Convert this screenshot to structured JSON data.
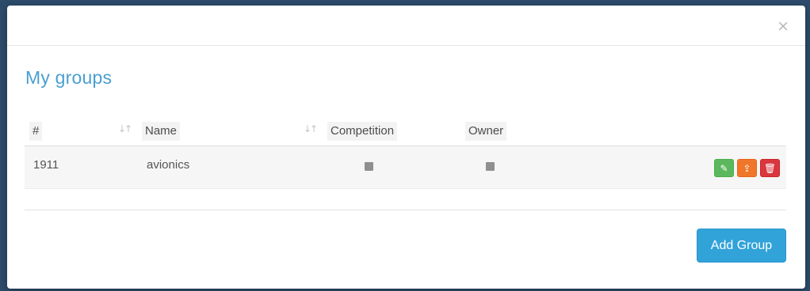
{
  "modal": {
    "close_glyph": "×",
    "title": "My groups"
  },
  "table": {
    "columns": [
      {
        "label": "#",
        "sortable": true
      },
      {
        "label": "Name",
        "sortable": true
      },
      {
        "label": "Competition",
        "sortable": false
      },
      {
        "label": "Owner",
        "sortable": false
      }
    ],
    "rows": [
      {
        "id": "1911",
        "name": "avionics",
        "competition": false,
        "owner": false
      }
    ],
    "row_actions": [
      {
        "name": "edit",
        "icon": "edit-icon",
        "glyph": "✎",
        "color": "#5cb85c"
      },
      {
        "name": "export",
        "icon": "export-icon",
        "glyph": "⇪",
        "color": "#f0762a"
      },
      {
        "name": "delete",
        "icon": "trash-icon",
        "glyph": "🗑",
        "color": "#d9363e"
      }
    ]
  },
  "footer": {
    "add_label": "Add Group"
  },
  "colors": {
    "title": "#4a9fd0",
    "primary_button": "#31a3d9"
  }
}
